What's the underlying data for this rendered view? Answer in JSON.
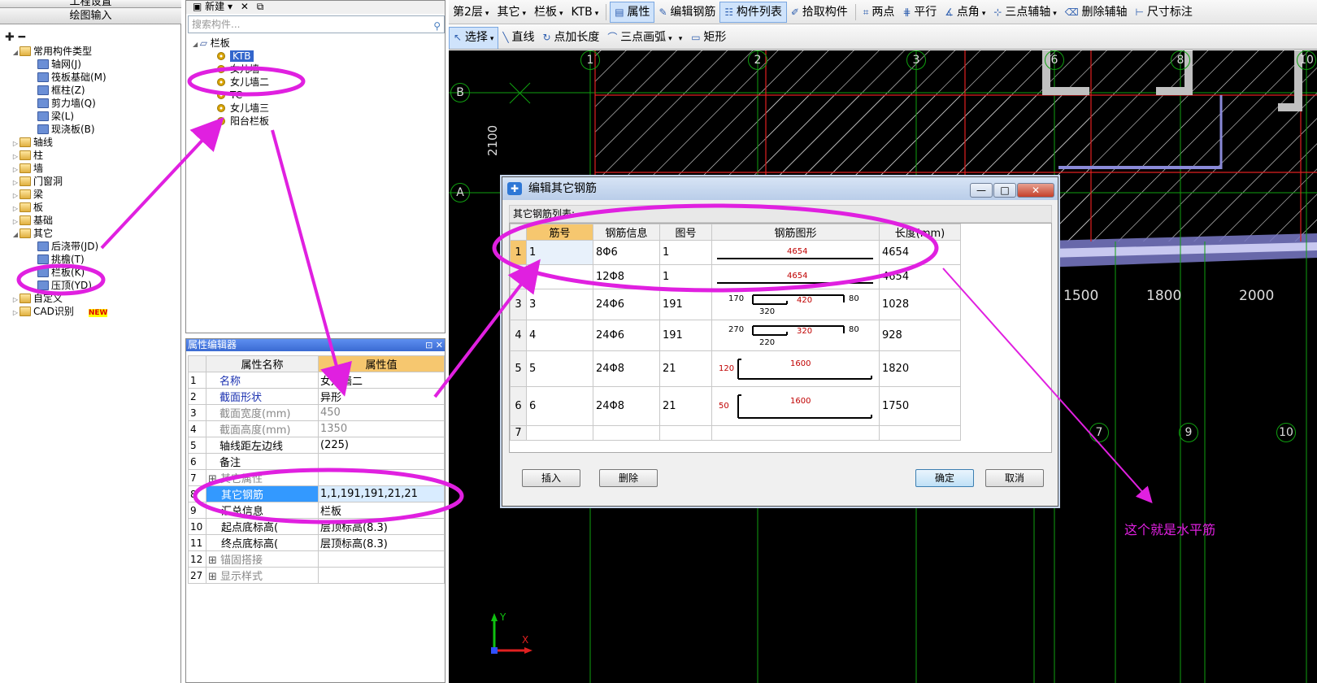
{
  "left_panel": {
    "tabs": [
      "工程设置",
      "绘图输入"
    ],
    "tree": [
      {
        "label": "常用构件类型",
        "folder": true,
        "expanded": true,
        "level": 0
      },
      {
        "label": "轴网(J)",
        "level": 1
      },
      {
        "label": "筏板基础(M)",
        "level": 1
      },
      {
        "label": "框柱(Z)",
        "level": 1
      },
      {
        "label": "剪力墙(Q)",
        "level": 1
      },
      {
        "label": "梁(L)",
        "level": 1
      },
      {
        "label": "现浇板(B)",
        "level": 1
      },
      {
        "label": "轴线",
        "folder": true,
        "level": 0
      },
      {
        "label": "柱",
        "folder": true,
        "level": 0
      },
      {
        "label": "墙",
        "folder": true,
        "level": 0
      },
      {
        "label": "门窗洞",
        "folder": true,
        "level": 0
      },
      {
        "label": "梁",
        "folder": true,
        "level": 0
      },
      {
        "label": "板",
        "folder": true,
        "level": 0
      },
      {
        "label": "基础",
        "folder": true,
        "level": 0
      },
      {
        "label": "其它",
        "folder": true,
        "expanded": true,
        "level": 0
      },
      {
        "label": "后浇带(JD)",
        "level": 1
      },
      {
        "label": "挑檐(T)",
        "level": 1
      },
      {
        "label": "栏板(K)",
        "level": 1
      },
      {
        "label": "压顶(YD)",
        "level": 1
      },
      {
        "label": "自定义",
        "folder": true,
        "level": 0
      },
      {
        "label": "CAD识别",
        "folder": true,
        "level": 0,
        "badge": "NEW"
      }
    ]
  },
  "component_tree": {
    "toolbar": [
      "新建",
      "✕"
    ],
    "search_placeholder": "搜索构件...",
    "root": "栏板",
    "items": [
      "KTB",
      "女儿墙",
      "女儿墙二",
      "TC",
      "女儿墙三",
      "阳台栏板"
    ],
    "selected": "KTB"
  },
  "property_editor": {
    "title": "属性编辑器",
    "col_name": "属性名称",
    "col_value": "属性值",
    "rows": [
      {
        "num": "1",
        "name": "名称",
        "value": "女儿墙二",
        "style": "blue"
      },
      {
        "num": "2",
        "name": "截面形状",
        "value": "异形",
        "style": "blue"
      },
      {
        "num": "3",
        "name": "截面宽度(mm)",
        "value": "450",
        "style": "gray"
      },
      {
        "num": "4",
        "name": "截面高度(mm)",
        "value": "1350",
        "style": "gray"
      },
      {
        "num": "5",
        "name": "轴线距左边线",
        "value": "(225)",
        "style": ""
      },
      {
        "num": "6",
        "name": "备注",
        "value": "",
        "style": ""
      },
      {
        "num": "7",
        "name": "其它属性",
        "value": "",
        "style": "gray",
        "group": "−"
      },
      {
        "num": "8",
        "name": "其它钢筋",
        "value": "1,1,191,191,21,21",
        "style": "",
        "highlight": true
      },
      {
        "num": "9",
        "name": "汇总信息",
        "value": "栏板",
        "style": ""
      },
      {
        "num": "10",
        "name": "起点底标高(",
        "value": "层顶标高(8.3)",
        "style": ""
      },
      {
        "num": "11",
        "name": "终点底标高(",
        "value": "层顶标高(8.3)",
        "style": ""
      },
      {
        "num": "12",
        "name": "锚固搭接",
        "value": "",
        "style": "gray",
        "group": "+"
      },
      {
        "num": "27",
        "name": "显示样式",
        "value": "",
        "style": "gray",
        "group": "+"
      }
    ]
  },
  "toolbar1": [
    {
      "label": "第2层",
      "dd": true
    },
    {
      "label": "其它",
      "dd": true
    },
    {
      "label": "栏板",
      "dd": true
    },
    {
      "label": "KTB",
      "dd": true
    },
    {
      "label": "属性",
      "pressed": true
    },
    {
      "label": "编辑钢筋"
    },
    {
      "label": "构件列表",
      "pressed": true
    },
    {
      "label": "拾取构件"
    },
    {
      "label": "两点"
    },
    {
      "label": "平行"
    },
    {
      "label": "点角",
      "dd": true
    },
    {
      "label": "三点辅轴",
      "dd": true
    },
    {
      "label": "删除辅轴"
    },
    {
      "label": "尺寸标注"
    }
  ],
  "toolbar2": [
    {
      "label": "选择",
      "dd": true,
      "pressed": true
    },
    {
      "label": "直线"
    },
    {
      "label": "点加长度"
    },
    {
      "label": "三点画弧",
      "dd": true
    },
    {
      "label": "矩形",
      "dd_before": true
    }
  ],
  "canvas": {
    "axis_top": [
      "1",
      "2",
      "3",
      "6",
      "8",
      "10"
    ],
    "axis_left": [
      "B",
      "A"
    ],
    "axis_bottom": [
      "7",
      "9",
      "10"
    ],
    "dimension_vertical": "2100",
    "dimensions": [
      "1500",
      "1800",
      "2000"
    ],
    "ucs_y": "Y",
    "ucs_x": "X"
  },
  "dialog": {
    "title": "编辑其它钢筋",
    "subtitle": "其它钢筋列表:",
    "columns": [
      "筋号",
      "钢筋信息",
      "图号",
      "钢筋图形",
      "长度(mm)"
    ],
    "rows": [
      {
        "rn": "1",
        "no": "1",
        "info": "8Φ6",
        "fig": "1",
        "len": "4654",
        "shape": "line",
        "labels": [
          "4654"
        ]
      },
      {
        "rn": "2",
        "no": "2",
        "info": "12Φ8",
        "fig": "1",
        "len": "4654",
        "shape": "line",
        "labels": [
          "4654"
        ]
      },
      {
        "rn": "3",
        "no": "3",
        "info": "24Φ6",
        "fig": "191",
        "len": "1028",
        "shape": "z",
        "labels": [
          "170",
          "420",
          "80",
          "320"
        ]
      },
      {
        "rn": "4",
        "no": "4",
        "info": "24Φ6",
        "fig": "191",
        "len": "928",
        "shape": "z",
        "labels": [
          "270",
          "320",
          "80",
          "220"
        ]
      },
      {
        "rn": "5",
        "no": "5",
        "info": "24Φ8",
        "fig": "21",
        "len": "1820",
        "shape": "l",
        "labels": [
          "120",
          "1600"
        ]
      },
      {
        "rn": "6",
        "no": "6",
        "info": "24Φ8",
        "fig": "21",
        "len": "1750",
        "shape": "l",
        "labels": [
          "50",
          "1600"
        ]
      },
      {
        "rn": "7",
        "no": "",
        "info": "",
        "fig": "",
        "len": "",
        "shape": "",
        "labels": []
      }
    ],
    "buttons": {
      "insert": "插入",
      "delete": "删除",
      "ok": "确定",
      "cancel": "取消"
    }
  },
  "annotation": {
    "note": "这个就是水平筋",
    "color": "#e020e0"
  }
}
